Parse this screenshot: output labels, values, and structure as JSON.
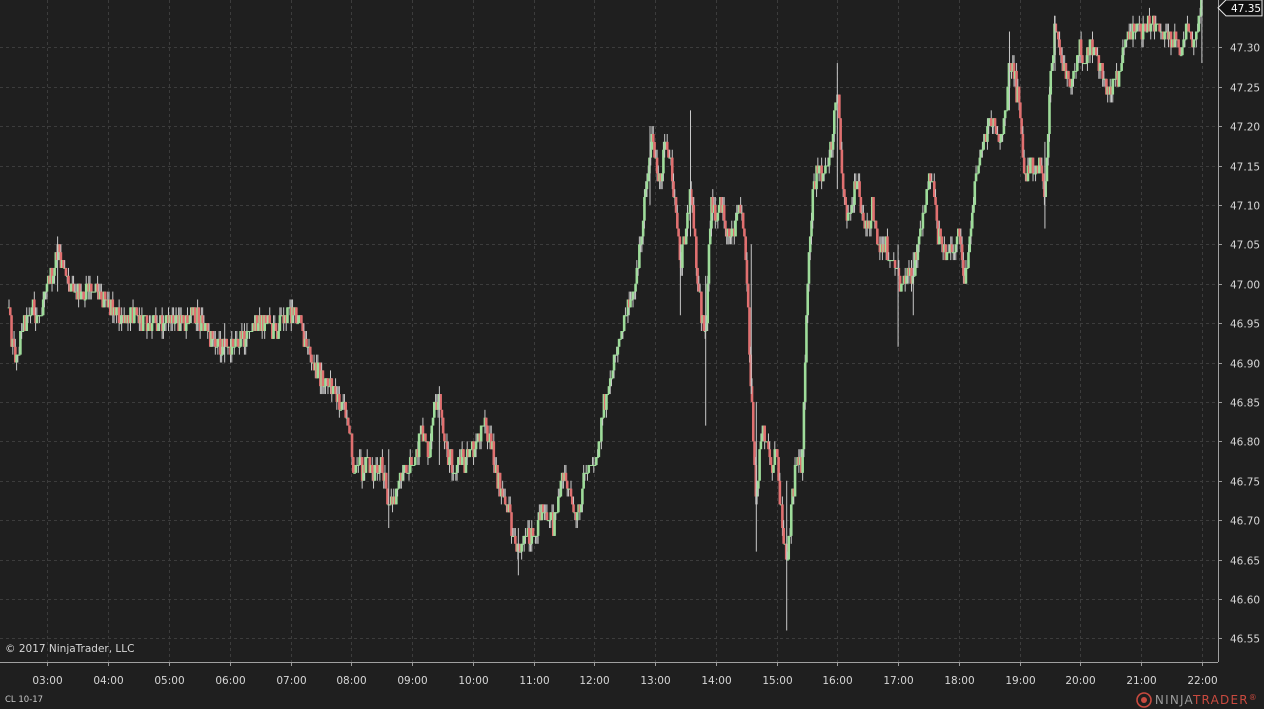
{
  "instrument": "CL 10-17",
  "copyright": "© 2017 NinjaTrader, LLC",
  "brand": {
    "part1": "NINJA",
    "part2": "TRADER",
    "reg": "®"
  },
  "last_price_label": "47.35",
  "colors": {
    "background": "#1f1f1f",
    "grid": "#3c3c3c",
    "up": "#9edc9a",
    "down": "#e07070",
    "wick": "#c8c8c8",
    "axis_text": "#d6d6d6"
  },
  "chart_data": {
    "type": "candlestick",
    "x_tick_labels": [
      "03:00",
      "04:00",
      "05:00",
      "06:00",
      "07:00",
      "08:00",
      "09:00",
      "10:00",
      "11:00",
      "12:00",
      "13:00",
      "14:00",
      "15:00",
      "16:00",
      "17:00",
      "18:00",
      "19:00",
      "20:00",
      "21:00",
      "22:00"
    ],
    "y_tick_labels": [
      "46.55",
      "46.60",
      "46.65",
      "46.70",
      "46.75",
      "46.80",
      "46.85",
      "46.90",
      "46.95",
      "47.00",
      "47.05",
      "47.10",
      "47.15",
      "47.20",
      "47.25",
      "47.30"
    ],
    "xlim": [
      "02:22",
      "22:10"
    ],
    "ylim": [
      46.52,
      47.36
    ],
    "grid": true,
    "last_price": 47.35,
    "series": [
      {
        "close_path": [
          [
            "02:22",
            46.97
          ],
          [
            "02:25",
            46.92
          ],
          [
            "02:30",
            46.9
          ],
          [
            "02:35",
            46.94
          ],
          [
            "02:40",
            46.95
          ],
          [
            "02:45",
            46.97
          ],
          [
            "02:50",
            46.96
          ],
          [
            "02:55",
            46.96
          ],
          [
            "03:00",
            47.0
          ],
          [
            "03:05",
            47.01
          ],
          [
            "03:10",
            47.05
          ],
          [
            "03:15",
            47.02
          ],
          [
            "03:20",
            47.01
          ],
          [
            "03:25",
            46.99
          ],
          [
            "03:35",
            46.99
          ],
          [
            "03:45",
            46.99
          ],
          [
            "04:00",
            46.97
          ],
          [
            "04:10",
            46.96
          ],
          [
            "04:20",
            46.96
          ],
          [
            "04:35",
            46.95
          ],
          [
            "04:45",
            46.95
          ],
          [
            "05:00",
            46.96
          ],
          [
            "05:10",
            46.95
          ],
          [
            "05:25",
            46.96
          ],
          [
            "05:35",
            46.95
          ],
          [
            "05:45",
            46.92
          ],
          [
            "05:55",
            46.92
          ],
          [
            "06:05",
            46.92
          ],
          [
            "06:15",
            46.93
          ],
          [
            "06:25",
            46.95
          ],
          [
            "06:35",
            46.95
          ],
          [
            "06:45",
            46.94
          ],
          [
            "06:55",
            46.96
          ],
          [
            "07:05",
            46.96
          ],
          [
            "07:15",
            46.93
          ],
          [
            "07:22",
            46.9
          ],
          [
            "07:30",
            46.88
          ],
          [
            "07:40",
            46.87
          ],
          [
            "07:50",
            46.85
          ],
          [
            "07:57",
            46.83
          ],
          [
            "08:02",
            46.77
          ],
          [
            "08:07",
            46.78
          ],
          [
            "08:12",
            46.76
          ],
          [
            "08:17",
            46.78
          ],
          [
            "08:22",
            46.76
          ],
          [
            "08:30",
            46.78
          ],
          [
            "08:37",
            46.71
          ],
          [
            "08:45",
            46.74
          ],
          [
            "08:52",
            46.76
          ],
          [
            "09:00",
            46.77
          ],
          [
            "09:07",
            46.8
          ],
          [
            "09:12",
            46.81
          ],
          [
            "09:17",
            46.79
          ],
          [
            "09:22",
            46.84
          ],
          [
            "09:27",
            46.85
          ],
          [
            "09:32",
            46.79
          ],
          [
            "09:37",
            46.78
          ],
          [
            "09:42",
            46.76
          ],
          [
            "09:47",
            46.78
          ],
          [
            "09:52",
            46.77
          ],
          [
            "09:57",
            46.8
          ],
          [
            "10:02",
            46.79
          ],
          [
            "10:07",
            46.81
          ],
          [
            "10:12",
            46.83
          ],
          [
            "10:17",
            46.8
          ],
          [
            "10:22",
            46.77
          ],
          [
            "10:27",
            46.74
          ],
          [
            "10:32",
            46.73
          ],
          [
            "10:35",
            46.72
          ],
          [
            "10:40",
            46.67
          ],
          [
            "10:45",
            46.66
          ],
          [
            "10:50",
            46.67
          ],
          [
            "10:55",
            46.68
          ],
          [
            "11:00",
            46.69
          ],
          [
            "11:05",
            46.7
          ],
          [
            "11:10",
            46.71
          ],
          [
            "11:15",
            46.71
          ],
          [
            "11:20",
            46.69
          ],
          [
            "11:25",
            46.73
          ],
          [
            "11:30",
            46.76
          ],
          [
            "11:35",
            46.74
          ],
          [
            "11:40",
            46.71
          ],
          [
            "11:45",
            46.72
          ],
          [
            "11:50",
            46.75
          ],
          [
            "11:55",
            46.77
          ],
          [
            "12:00",
            46.76
          ],
          [
            "12:05",
            46.8
          ],
          [
            "12:10",
            46.85
          ],
          [
            "12:15",
            46.88
          ],
          [
            "12:20",
            46.91
          ],
          [
            "12:25",
            46.92
          ],
          [
            "12:30",
            46.96
          ],
          [
            "12:35",
            46.98
          ],
          [
            "12:40",
            46.99
          ],
          [
            "12:45",
            47.05
          ],
          [
            "12:50",
            47.1
          ],
          [
            "12:55",
            47.18
          ],
          [
            "13:00",
            47.17
          ],
          [
            "13:05",
            47.13
          ],
          [
            "13:10",
            47.18
          ],
          [
            "13:15",
            47.16
          ],
          [
            "13:20",
            47.1
          ],
          [
            "13:25",
            47.02
          ],
          [
            "13:30",
            47.06
          ],
          [
            "13:35",
            47.12
          ],
          [
            "13:40",
            47.04
          ],
          [
            "13:45",
            46.97
          ],
          [
            "13:50",
            46.94
          ],
          [
            "13:55",
            47.1
          ],
          [
            "14:00",
            47.08
          ],
          [
            "14:05",
            47.1
          ],
          [
            "14:10",
            47.07
          ],
          [
            "14:15",
            47.05
          ],
          [
            "14:20",
            47.08
          ],
          [
            "14:25",
            47.1
          ],
          [
            "14:30",
            47.04
          ],
          [
            "14:35",
            46.86
          ],
          [
            "14:40",
            46.72
          ],
          [
            "14:45",
            46.82
          ],
          [
            "14:50",
            46.8
          ],
          [
            "14:55",
            46.76
          ],
          [
            "15:00",
            46.79
          ],
          [
            "15:05",
            46.7
          ],
          [
            "15:10",
            46.64
          ],
          [
            "15:15",
            46.72
          ],
          [
            "15:20",
            46.78
          ],
          [
            "15:25",
            46.76
          ],
          [
            "15:30",
            46.98
          ],
          [
            "15:35",
            47.1
          ],
          [
            "15:40",
            47.15
          ],
          [
            "15:45",
            47.14
          ],
          [
            "15:50",
            47.16
          ],
          [
            "15:55",
            47.18
          ],
          [
            "16:00",
            47.25
          ],
          [
            "16:05",
            47.12
          ],
          [
            "16:10",
            47.08
          ],
          [
            "16:15",
            47.1
          ],
          [
            "16:20",
            47.14
          ],
          [
            "16:25",
            47.08
          ],
          [
            "16:30",
            47.06
          ],
          [
            "16:35",
            47.1
          ],
          [
            "16:40",
            47.04
          ],
          [
            "16:45",
            47.05
          ],
          [
            "16:50",
            47.04
          ],
          [
            "17:00",
            47.01
          ],
          [
            "17:05",
            47.0
          ],
          [
            "17:10",
            47.02
          ],
          [
            "17:15",
            47.01
          ],
          [
            "17:20",
            47.05
          ],
          [
            "17:25",
            47.1
          ],
          [
            "17:30",
            47.13
          ],
          [
            "17:35",
            47.12
          ],
          [
            "17:40",
            47.06
          ],
          [
            "17:45",
            47.05
          ],
          [
            "17:50",
            47.03
          ],
          [
            "17:55",
            47.05
          ],
          [
            "18:00",
            47.06
          ],
          [
            "18:05",
            47.0
          ],
          [
            "18:10",
            47.04
          ],
          [
            "18:15",
            47.12
          ],
          [
            "18:20",
            47.15
          ],
          [
            "18:25",
            47.18
          ],
          [
            "18:30",
            47.2
          ],
          [
            "18:35",
            47.22
          ],
          [
            "18:40",
            47.18
          ],
          [
            "18:45",
            47.2
          ],
          [
            "18:50",
            47.28
          ],
          [
            "18:55",
            47.26
          ],
          [
            "19:00",
            47.22
          ],
          [
            "19:05",
            47.13
          ],
          [
            "19:10",
            47.15
          ],
          [
            "19:15",
            47.14
          ],
          [
            "19:20",
            47.15
          ],
          [
            "19:25",
            47.1
          ],
          [
            "19:30",
            47.25
          ],
          [
            "19:35",
            47.33
          ],
          [
            "19:40",
            47.3
          ],
          [
            "19:45",
            47.27
          ],
          [
            "19:50",
            47.24
          ],
          [
            "19:55",
            47.27
          ],
          [
            "20:00",
            47.3
          ],
          [
            "20:05",
            47.28
          ],
          [
            "20:10",
            47.3
          ],
          [
            "20:15",
            47.29
          ],
          [
            "20:20",
            47.28
          ],
          [
            "20:25",
            47.25
          ],
          [
            "20:30",
            47.24
          ],
          [
            "20:35",
            47.26
          ],
          [
            "20:40",
            47.27
          ],
          [
            "20:45",
            47.31
          ],
          [
            "20:50",
            47.32
          ],
          [
            "20:55",
            47.33
          ],
          [
            "21:00",
            47.32
          ],
          [
            "21:05",
            47.33
          ],
          [
            "21:10",
            47.33
          ],
          [
            "21:15",
            47.32
          ],
          [
            "21:20",
            47.32
          ],
          [
            "21:25",
            47.31
          ],
          [
            "21:30",
            47.3
          ],
          [
            "21:35",
            47.31
          ],
          [
            "21:40",
            47.29
          ],
          [
            "21:45",
            47.33
          ],
          [
            "21:50",
            47.3
          ],
          [
            "21:55",
            47.32
          ],
          [
            "22:00",
            47.35
          ]
        ],
        "wick_spikes": [
          [
            "03:10",
            47.06,
            46.99
          ],
          [
            "05:55",
            46.95,
            46.9
          ],
          [
            "08:37",
            46.79,
            46.69
          ],
          [
            "09:27",
            46.86,
            46.77
          ],
          [
            "10:45",
            46.69,
            46.63
          ],
          [
            "12:55",
            47.2,
            47.1
          ],
          [
            "13:25",
            47.05,
            46.96
          ],
          [
            "13:35",
            47.22,
            47.06
          ],
          [
            "13:50",
            47.01,
            46.82
          ],
          [
            "14:35",
            47.05,
            46.86
          ],
          [
            "14:40",
            46.85,
            46.66
          ],
          [
            "15:10",
            46.75,
            46.56
          ],
          [
            "16:00",
            47.28,
            47.12
          ],
          [
            "17:00",
            47.05,
            46.92
          ],
          [
            "17:15",
            47.04,
            46.96
          ],
          [
            "18:50",
            47.32,
            47.22
          ],
          [
            "19:25",
            47.18,
            47.07
          ],
          [
            "19:35",
            47.34,
            47.27
          ],
          [
            "22:00",
            47.36,
            47.28
          ]
        ]
      }
    ]
  }
}
